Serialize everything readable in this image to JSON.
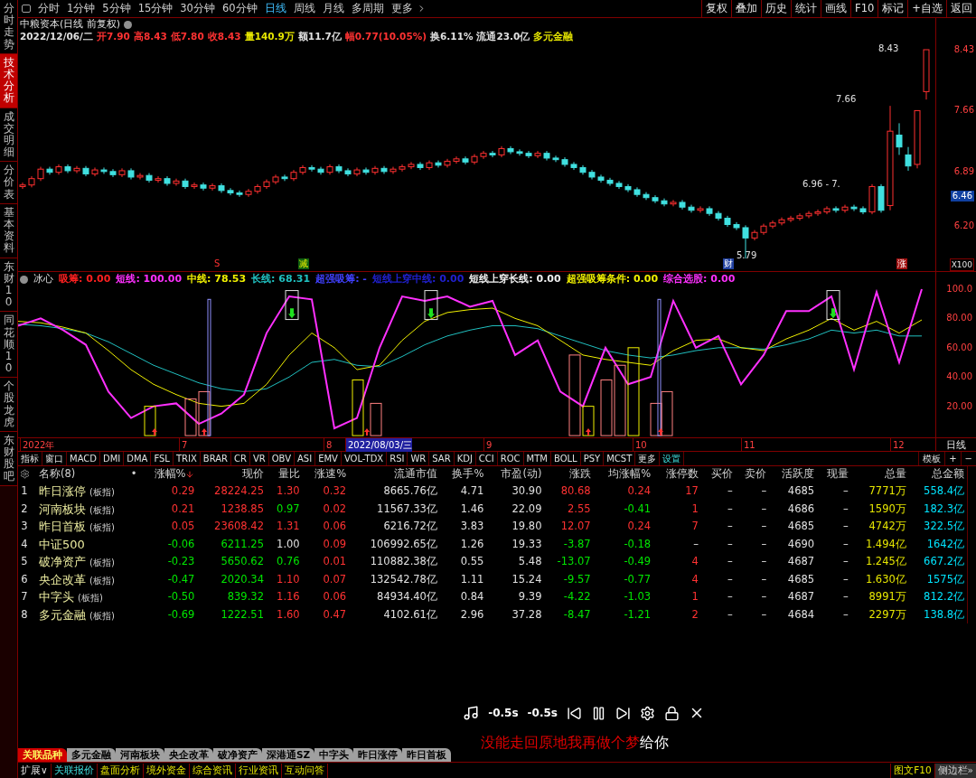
{
  "sidebar_tabs": [
    {
      "label": "分时走势",
      "selected": false
    },
    {
      "label": "技术分析",
      "selected": true
    },
    {
      "label": "成交明细",
      "selected": false
    },
    {
      "label": "分价表",
      "selected": false
    },
    {
      "label": "基本资料",
      "selected": false
    },
    {
      "label": "东财10",
      "selected": false
    },
    {
      "label": "同花顺10",
      "selected": false
    },
    {
      "label": "个股龙虎",
      "selected": false
    },
    {
      "label": "东财股吧",
      "selected": false
    }
  ],
  "period_tabs": [
    {
      "label": "分时",
      "selected": false
    },
    {
      "label": "1分钟",
      "selected": false
    },
    {
      "label": "5分钟",
      "selected": false
    },
    {
      "label": "15分钟",
      "selected": false
    },
    {
      "label": "30分钟",
      "selected": false
    },
    {
      "label": "60分钟",
      "selected": false
    },
    {
      "label": "日线",
      "selected": true
    },
    {
      "label": "周线",
      "selected": false
    },
    {
      "label": "月线",
      "selected": false
    },
    {
      "label": "多周期",
      "selected": false
    },
    {
      "label": "更多",
      "selected": false
    }
  ],
  "toolbar_buttons": [
    "复权",
    "叠加",
    "历史",
    "统计",
    "画线",
    "F10",
    "标记",
    "+自选",
    "返回"
  ],
  "stock_title": "中粮资本(日线 前复权)",
  "quote_line": [
    {
      "text": "2022/12/06/二",
      "color": "#e0e0e0"
    },
    {
      "text": "开7.90",
      "color": "#ff3232"
    },
    {
      "text": "高8.43",
      "color": "#ff3232"
    },
    {
      "text": "低7.80",
      "color": "#ff3232"
    },
    {
      "text": "收8.43",
      "color": "#ff3232"
    },
    {
      "text": "量140.9万",
      "color": "#e6e600"
    },
    {
      "text": "额11.7亿",
      "color": "#e0e0e0"
    },
    {
      "text": "幅0.77(10.05%)",
      "color": "#ff3232"
    },
    {
      "text": "换6.11%",
      "color": "#e0e0e0"
    },
    {
      "text": "流通23.0亿",
      "color": "#e0e0e0"
    },
    {
      "text": "多元金融",
      "color": "#e6e600"
    }
  ],
  "price_chart": {
    "cursor_price": "6.46",
    "chart_data": {
      "type": "candlestick",
      "ylim": [
        5.62,
        8.51
      ],
      "yticks": [
        {
          "value": 8.43,
          "label": "8.43"
        },
        {
          "value": 7.66,
          "label": "7.66"
        },
        {
          "value": 6.89,
          "label": "6.89"
        },
        {
          "value": 6.2,
          "label": "6.20"
        }
      ],
      "ohlc": [
        [
          6.7,
          6.75,
          6.67,
          6.72
        ],
        [
          6.72,
          6.83,
          6.69,
          6.8
        ],
        [
          6.8,
          6.95,
          6.77,
          6.92
        ],
        [
          6.92,
          6.95,
          6.85,
          6.88
        ],
        [
          6.88,
          6.98,
          6.85,
          6.95
        ],
        [
          6.95,
          6.98,
          6.87,
          6.9
        ],
        [
          6.9,
          6.96,
          6.87,
          6.93
        ],
        [
          6.93,
          6.96,
          6.83,
          6.86
        ],
        [
          6.86,
          6.94,
          6.83,
          6.91
        ],
        [
          6.91,
          6.94,
          6.86,
          6.89
        ],
        [
          6.89,
          6.92,
          6.82,
          6.85
        ],
        [
          6.85,
          6.93,
          6.82,
          6.9
        ],
        [
          6.9,
          6.93,
          6.79,
          6.82
        ],
        [
          6.82,
          6.87,
          6.79,
          6.84
        ],
        [
          6.84,
          6.87,
          6.75,
          6.78
        ],
        [
          6.78,
          6.83,
          6.75,
          6.8
        ],
        [
          6.8,
          6.83,
          6.71,
          6.74
        ],
        [
          6.74,
          6.8,
          6.71,
          6.77
        ],
        [
          6.77,
          6.8,
          6.67,
          6.7
        ],
        [
          6.7,
          6.75,
          6.67,
          6.72
        ],
        [
          6.72,
          6.75,
          6.65,
          6.68
        ],
        [
          6.68,
          6.74,
          6.65,
          6.71
        ],
        [
          6.71,
          6.74,
          6.62,
          6.65
        ],
        [
          6.65,
          6.68,
          6.59,
          6.62
        ],
        [
          6.62,
          6.65,
          6.57,
          6.6
        ],
        [
          6.6,
          6.67,
          6.57,
          6.64
        ],
        [
          6.64,
          6.73,
          6.61,
          6.7
        ],
        [
          6.7,
          6.79,
          6.67,
          6.76
        ],
        [
          6.76,
          6.85,
          6.73,
          6.82
        ],
        [
          6.82,
          6.85,
          6.77,
          6.8
        ],
        [
          6.8,
          6.91,
          6.77,
          6.88
        ],
        [
          6.88,
          6.97,
          6.85,
          6.94
        ],
        [
          6.94,
          6.97,
          6.89,
          6.92
        ],
        [
          6.92,
          6.95,
          6.85,
          6.88
        ],
        [
          6.88,
          6.98,
          6.85,
          6.95
        ],
        [
          6.95,
          6.98,
          6.87,
          6.9
        ],
        [
          6.9,
          6.93,
          6.83,
          6.86
        ],
        [
          6.86,
          6.94,
          6.83,
          6.91
        ],
        [
          6.91,
          6.94,
          6.85,
          6.88
        ],
        [
          6.88,
          6.96,
          6.85,
          6.93
        ],
        [
          6.93,
          6.96,
          6.86,
          6.89
        ],
        [
          6.89,
          6.95,
          6.86,
          6.92
        ],
        [
          6.92,
          6.98,
          6.89,
          6.95
        ],
        [
          6.95,
          7.01,
          6.92,
          6.98
        ],
        [
          6.98,
          7.01,
          6.91,
          6.94
        ],
        [
          6.94,
          7.03,
          6.91,
          7.0
        ],
        [
          7.0,
          7.03,
          6.94,
          6.97
        ],
        [
          6.97,
          7.05,
          6.94,
          7.02
        ],
        [
          7.02,
          7.08,
          6.99,
          7.05
        ],
        [
          7.05,
          7.08,
          6.98,
          7.01
        ],
        [
          7.01,
          7.11,
          6.98,
          7.08
        ],
        [
          7.08,
          7.15,
          7.05,
          7.12
        ],
        [
          7.12,
          7.15,
          7.07,
          7.1
        ],
        [
          7.1,
          7.21,
          7.07,
          7.18
        ],
        [
          7.18,
          7.21,
          7.11,
          7.14
        ],
        [
          7.14,
          7.17,
          7.09,
          7.12
        ],
        [
          7.12,
          7.15,
          7.06,
          7.09
        ],
        [
          7.09,
          7.15,
          7.06,
          7.12
        ],
        [
          7.12,
          7.15,
          7.03,
          7.06
        ],
        [
          7.06,
          7.09,
          7.01,
          7.04
        ],
        [
          7.04,
          7.07,
          6.95,
          6.98
        ],
        [
          6.98,
          7.01,
          6.91,
          6.94
        ],
        [
          6.94,
          6.97,
          6.85,
          6.88
        ],
        [
          6.88,
          6.91,
          6.79,
          6.82
        ],
        [
          6.82,
          6.85,
          6.75,
          6.78
        ],
        [
          6.78,
          6.81,
          6.71,
          6.74
        ],
        [
          6.74,
          6.77,
          6.67,
          6.7
        ],
        [
          6.7,
          6.73,
          6.63,
          6.66
        ],
        [
          6.66,
          6.69,
          6.57,
          6.6
        ],
        [
          6.6,
          6.63,
          6.53,
          6.56
        ],
        [
          6.56,
          6.59,
          6.49,
          6.52
        ],
        [
          6.52,
          6.55,
          6.45,
          6.48
        ],
        [
          6.48,
          6.53,
          6.45,
          6.5
        ],
        [
          6.5,
          6.53,
          6.41,
          6.44
        ],
        [
          6.44,
          6.47,
          6.37,
          6.4
        ],
        [
          6.4,
          6.45,
          6.37,
          6.42
        ],
        [
          6.42,
          6.45,
          6.33,
          6.36
        ],
        [
          6.36,
          6.39,
          6.27,
          6.3
        ],
        [
          6.3,
          6.33,
          6.19,
          6.22
        ],
        [
          6.22,
          6.25,
          6.15,
          6.18
        ],
        [
          6.18,
          6.21,
          5.79,
          6.05
        ],
        [
          6.05,
          6.15,
          6.02,
          6.12
        ],
        [
          6.12,
          6.23,
          6.09,
          6.2
        ],
        [
          6.2,
          6.27,
          6.17,
          6.24
        ],
        [
          6.24,
          6.31,
          6.21,
          6.28
        ],
        [
          6.28,
          6.33,
          6.25,
          6.3
        ],
        [
          6.3,
          6.36,
          6.27,
          6.33
        ],
        [
          6.33,
          6.39,
          6.3,
          6.36
        ],
        [
          6.36,
          6.41,
          6.33,
          6.38
        ],
        [
          6.38,
          6.45,
          6.35,
          6.42
        ],
        [
          6.42,
          6.45,
          6.37,
          6.4
        ],
        [
          6.4,
          6.47,
          6.37,
          6.44
        ],
        [
          6.44,
          6.47,
          6.39,
          6.42
        ],
        [
          6.42,
          6.45,
          6.35,
          6.38
        ],
        [
          6.38,
          6.73,
          6.35,
          6.7
        ],
        [
          6.7,
          6.73,
          6.37,
          6.4
        ],
        [
          6.46,
          7.72,
          6.4,
          7.4
        ],
        [
          7.35,
          7.5,
          7.1,
          7.2
        ],
        [
          7.1,
          7.2,
          6.9,
          6.96
        ],
        [
          6.98,
          7.66,
          6.93,
          7.66
        ],
        [
          7.9,
          8.43,
          7.8,
          8.43
        ]
      ]
    }
  },
  "chart_marks": {
    "high": "8.43",
    "last": "7.66",
    "range": "6.96 - 7.",
    "low": "5.79",
    "signal_s": "S",
    "signal_cut": "减",
    "signal_fin": "财",
    "signal_up": "涨",
    "scale": "X100"
  },
  "indicator": {
    "name": "冰心",
    "params": [
      {
        "text": "吸筹: 0.00",
        "color": "#ff2020"
      },
      {
        "text": "短线: 100.00",
        "color": "#ff30ff"
      },
      {
        "text": "中线: 78.53",
        "color": "#f0f000"
      },
      {
        "text": "长线: 68.31",
        "color": "#20c0c0"
      },
      {
        "text": "超强吸筹: -",
        "color": "#4040ff"
      },
      {
        "text": "短线上穿中线: 0.00",
        "color": "#2020d0"
      },
      {
        "text": "短线上穿长线: 0.00",
        "color": "#f0f0f0"
      },
      {
        "text": "超强吸筹条件: 0.00",
        "color": "#f0f000"
      },
      {
        "text": "综合选股: 0.00",
        "color": "#ff30ff"
      }
    ],
    "chart_data": {
      "type": "line",
      "ylim": [
        -1.2,
        101.2
      ],
      "yticks": [
        {
          "value": 100,
          "label": "100.0"
        },
        {
          "value": 80,
          "label": "80.00"
        },
        {
          "value": 60,
          "label": "60.00"
        },
        {
          "value": 40,
          "label": "40.00"
        },
        {
          "value": 20,
          "label": "20.00"
        }
      ],
      "series": [
        {
          "color": "#ff30ff",
          "values": [
            75,
            80,
            72,
            62,
            30,
            12,
            20,
            22,
            8,
            15,
            28,
            70,
            95,
            93,
            5,
            12,
            60,
            95,
            92,
            95,
            88,
            92,
            55,
            65,
            30,
            20,
            60,
            35,
            40,
            92,
            60,
            68,
            35,
            55,
            85,
            85,
            95,
            45,
            98,
            50,
            100
          ]
        },
        {
          "color": "#f0f000",
          "values": [
            78,
            77,
            74,
            70,
            58,
            45,
            35,
            28,
            22,
            20,
            22,
            35,
            55,
            70,
            60,
            45,
            48,
            65,
            78,
            84,
            86,
            87,
            80,
            75,
            65,
            55,
            52,
            50,
            48,
            58,
            65,
            66,
            60,
            58,
            66,
            72,
            80,
            72,
            78,
            70,
            79
          ]
        },
        {
          "color": "#20c0c0",
          "values": [
            76,
            75,
            73,
            70,
            64,
            56,
            48,
            42,
            36,
            32,
            30,
            32,
            40,
            50,
            52,
            48,
            47,
            54,
            62,
            68,
            72,
            75,
            75,
            73,
            68,
            63,
            58,
            55,
            53,
            55,
            58,
            60,
            60,
            59,
            62,
            66,
            72,
            70,
            72,
            68,
            68
          ]
        }
      ]
    }
  },
  "date_axis": [
    {
      "text": "2022年",
      "selected": false
    },
    {
      "text": "7",
      "selected": false
    },
    {
      "text": "8",
      "selected": false
    },
    {
      "text": "2022/08/03/三",
      "selected": true
    },
    {
      "text": "9",
      "selected": false
    },
    {
      "text": "10",
      "selected": false
    },
    {
      "text": "11",
      "selected": false
    },
    {
      "text": "12",
      "selected": false
    }
  ],
  "period_label": "日线",
  "indicator_tabs": [
    {
      "label": "指标",
      "selected": false
    },
    {
      "label": "窗口",
      "selected": false
    },
    {
      "label": "MACD",
      "selected": false
    },
    {
      "label": "DMI",
      "selected": false
    },
    {
      "label": "DMA",
      "selected": false
    },
    {
      "label": "FSL",
      "selected": false
    },
    {
      "label": "TRIX",
      "selected": false
    },
    {
      "label": "BRAR",
      "selected": false
    },
    {
      "label": "CR",
      "selected": false
    },
    {
      "label": "VR",
      "selected": false
    },
    {
      "label": "OBV",
      "selected": false
    },
    {
      "label": "ASI",
      "selected": false
    },
    {
      "label": "EMV",
      "selected": false
    },
    {
      "label": "VOL-TDX",
      "selected": false
    },
    {
      "label": "RSI",
      "selected": false
    },
    {
      "label": "WR",
      "selected": false
    },
    {
      "label": "SAR",
      "selected": false
    },
    {
      "label": "KDJ",
      "selected": false
    },
    {
      "label": "CCI",
      "selected": false
    },
    {
      "label": "ROC",
      "selected": false
    },
    {
      "label": "MTM",
      "selected": false
    },
    {
      "label": "BOLL",
      "selected": false
    },
    {
      "label": "PSY",
      "selected": false
    },
    {
      "label": "MCST",
      "selected": false
    },
    {
      "label": "更多",
      "selected": false
    },
    {
      "label": "设置",
      "selected": true
    }
  ],
  "indicator_tools": [
    "模板",
    "+",
    "−"
  ],
  "table": {
    "pin_header": "•",
    "columns": [
      "名称(8)",
      "涨幅%",
      "现价",
      "量比",
      "涨速%",
      "流通市值",
      "换手%",
      "市盈(动)",
      "涨跌",
      "均涨幅%",
      "涨停数",
      "买价",
      "卖价",
      "活跃度",
      "现量",
      "总量",
      "总金额"
    ],
    "rows": [
      {
        "no": "1",
        "cells": [
          {
            "text": "昨日涨停",
            "tag": "(板指)"
          },
          {
            "text": "0.29",
            "color": "#ff3232"
          },
          {
            "text": "28224.25",
            "color": "#ff3232"
          },
          {
            "text": "1.30",
            "color": "#ff3232"
          },
          {
            "text": "0.32",
            "color": "#ff3232"
          },
          {
            "text": "8665.76亿"
          },
          {
            "text": "4.71"
          },
          {
            "text": "30.90"
          },
          {
            "text": "80.68",
            "color": "#ff3232"
          },
          {
            "text": "0.24",
            "color": "#ff3232"
          },
          {
            "text": "17",
            "color": "#ff3232"
          },
          {
            "text": "–"
          },
          {
            "text": "–"
          },
          {
            "text": "4685"
          },
          {
            "text": "–"
          },
          {
            "text": "7771万",
            "color": "#e6e600"
          },
          {
            "text": "558.4亿",
            "color": "#00e5ff"
          }
        ]
      },
      {
        "no": "2",
        "cells": [
          {
            "text": "河南板块",
            "tag": "(板指)"
          },
          {
            "text": "0.21",
            "color": "#ff3232"
          },
          {
            "text": "1238.85",
            "color": "#ff3232"
          },
          {
            "text": "0.97",
            "color": "#00e600"
          },
          {
            "text": "0.02",
            "color": "#ff3232"
          },
          {
            "text": "11567.33亿"
          },
          {
            "text": "1.46"
          },
          {
            "text": "22.09"
          },
          {
            "text": "2.55",
            "color": "#ff3232"
          },
          {
            "text": "-0.41",
            "color": "#00e600"
          },
          {
            "text": "1",
            "color": "#ff3232"
          },
          {
            "text": "–"
          },
          {
            "text": "–"
          },
          {
            "text": "4686"
          },
          {
            "text": "–"
          },
          {
            "text": "1590万",
            "color": "#e6e600"
          },
          {
            "text": "182.3亿",
            "color": "#00e5ff"
          }
        ]
      },
      {
        "no": "3",
        "cells": [
          {
            "text": "昨日首板",
            "tag": "(板指)"
          },
          {
            "text": "0.05",
            "color": "#ff3232"
          },
          {
            "text": "23608.42",
            "color": "#ff3232"
          },
          {
            "text": "1.31",
            "color": "#ff3232"
          },
          {
            "text": "0.06",
            "color": "#ff3232"
          },
          {
            "text": "6216.72亿"
          },
          {
            "text": "3.83"
          },
          {
            "text": "19.80"
          },
          {
            "text": "12.07",
            "color": "#ff3232"
          },
          {
            "text": "0.24",
            "color": "#ff3232"
          },
          {
            "text": "7",
            "color": "#ff3232"
          },
          {
            "text": "–"
          },
          {
            "text": "–"
          },
          {
            "text": "4685"
          },
          {
            "text": "–"
          },
          {
            "text": "4742万",
            "color": "#e6e600"
          },
          {
            "text": "322.5亿",
            "color": "#00e5ff"
          }
        ]
      },
      {
        "no": "4",
        "cells": [
          {
            "text": "中证500"
          },
          {
            "text": "-0.06",
            "color": "#00e600"
          },
          {
            "text": "6211.25",
            "color": "#00e600"
          },
          {
            "text": "1.00"
          },
          {
            "text": "0.09",
            "color": "#ff3232"
          },
          {
            "text": "106992.65亿"
          },
          {
            "text": "1.26"
          },
          {
            "text": "19.33"
          },
          {
            "text": "-3.87",
            "color": "#00e600"
          },
          {
            "text": "-0.18",
            "color": "#00e600"
          },
          {
            "text": "–"
          },
          {
            "text": "–"
          },
          {
            "text": "–"
          },
          {
            "text": "4690"
          },
          {
            "text": "–"
          },
          {
            "text": "1.494亿",
            "color": "#e6e600"
          },
          {
            "text": "1642亿",
            "color": "#00e5ff"
          }
        ]
      },
      {
        "no": "5",
        "cells": [
          {
            "text": "破净资产",
            "tag": "(板指)"
          },
          {
            "text": "-0.23",
            "color": "#00e600"
          },
          {
            "text": "5650.62",
            "color": "#00e600"
          },
          {
            "text": "0.76",
            "color": "#00e600"
          },
          {
            "text": "0.01",
            "color": "#ff3232"
          },
          {
            "text": "110882.38亿"
          },
          {
            "text": "0.55"
          },
          {
            "text": "5.48"
          },
          {
            "text": "-13.07",
            "color": "#00e600"
          },
          {
            "text": "-0.49",
            "color": "#00e600"
          },
          {
            "text": "4",
            "color": "#ff3232"
          },
          {
            "text": "–"
          },
          {
            "text": "–"
          },
          {
            "text": "4687"
          },
          {
            "text": "–"
          },
          {
            "text": "1.245亿",
            "color": "#e6e600"
          },
          {
            "text": "667.2亿",
            "color": "#00e5ff"
          }
        ]
      },
      {
        "no": "6",
        "cells": [
          {
            "text": "央企改革",
            "tag": "(板指)"
          },
          {
            "text": "-0.47",
            "color": "#00e600"
          },
          {
            "text": "2020.34",
            "color": "#00e600"
          },
          {
            "text": "1.10",
            "color": "#ff3232"
          },
          {
            "text": "0.07",
            "color": "#ff3232"
          },
          {
            "text": "132542.78亿"
          },
          {
            "text": "1.11"
          },
          {
            "text": "15.24"
          },
          {
            "text": "-9.57",
            "color": "#00e600"
          },
          {
            "text": "-0.77",
            "color": "#00e600"
          },
          {
            "text": "4",
            "color": "#ff3232"
          },
          {
            "text": "–"
          },
          {
            "text": "–"
          },
          {
            "text": "4685"
          },
          {
            "text": "–"
          },
          {
            "text": "1.630亿",
            "color": "#e6e600"
          },
          {
            "text": "1575亿",
            "color": "#00e5ff"
          }
        ]
      },
      {
        "no": "7",
        "cells": [
          {
            "text": "中字头",
            "tag": "(板指)"
          },
          {
            "text": "-0.50",
            "color": "#00e600"
          },
          {
            "text": "839.32",
            "color": "#00e600"
          },
          {
            "text": "1.16",
            "color": "#ff3232"
          },
          {
            "text": "0.06",
            "color": "#ff3232"
          },
          {
            "text": "84934.40亿"
          },
          {
            "text": "0.84"
          },
          {
            "text": "9.39"
          },
          {
            "text": "-4.22",
            "color": "#00e600"
          },
          {
            "text": "-1.03",
            "color": "#00e600"
          },
          {
            "text": "1",
            "color": "#ff3232"
          },
          {
            "text": "–"
          },
          {
            "text": "–"
          },
          {
            "text": "4687"
          },
          {
            "text": "–"
          },
          {
            "text": "8991万",
            "color": "#e6e600"
          },
          {
            "text": "812.2亿",
            "color": "#00e5ff"
          }
        ]
      },
      {
        "no": "8",
        "cells": [
          {
            "text": "多元金融",
            "tag": "(板指)"
          },
          {
            "text": "-0.69",
            "color": "#00e600"
          },
          {
            "text": "1222.51",
            "color": "#00e600"
          },
          {
            "text": "1.60",
            "color": "#ff3232"
          },
          {
            "text": "0.47",
            "color": "#ff3232"
          },
          {
            "text": "4102.61亿"
          },
          {
            "text": "2.96"
          },
          {
            "text": "37.28"
          },
          {
            "text": "-8.47",
            "color": "#00e600"
          },
          {
            "text": "-1.21",
            "color": "#00e600"
          },
          {
            "text": "2",
            "color": "#ff3232"
          },
          {
            "text": "–"
          },
          {
            "text": "–"
          },
          {
            "text": "4684"
          },
          {
            "text": "–"
          },
          {
            "text": "2297万",
            "color": "#e6e600"
          },
          {
            "text": "138.8亿",
            "color": "#00e5ff"
          }
        ]
      }
    ]
  },
  "player": {
    "rewind": "-0.5s",
    "forward": "-0.5s"
  },
  "lyric": {
    "sung": "没能走回原地我再做个梦",
    "rest": "给你"
  },
  "sector_tabs": [
    {
      "label": "关联品种",
      "selected": true
    },
    {
      "label": "多元金融",
      "selected": false
    },
    {
      "label": "河南板块",
      "selected": false
    },
    {
      "label": "央企改革",
      "selected": false
    },
    {
      "label": "破净资产",
      "selected": false
    },
    {
      "label": "深港通SZ",
      "selected": false
    },
    {
      "label": "中字头",
      "selected": false
    },
    {
      "label": "昨日涨停",
      "selected": false
    },
    {
      "label": "昨日首板",
      "selected": false
    }
  ],
  "bottom_tabs": [
    {
      "label": "扩展∨",
      "selected": false
    },
    {
      "label": "关联报价",
      "selected": true
    },
    {
      "label": "盘面分析",
      "selected": false
    },
    {
      "label": "境外资金",
      "selected": false
    },
    {
      "label": "综合资讯",
      "selected": false
    },
    {
      "label": "行业资讯",
      "selected": false
    },
    {
      "label": "互动问答",
      "selected": false
    }
  ],
  "bottom_right": [
    "图文F10",
    "侧边栏»"
  ]
}
